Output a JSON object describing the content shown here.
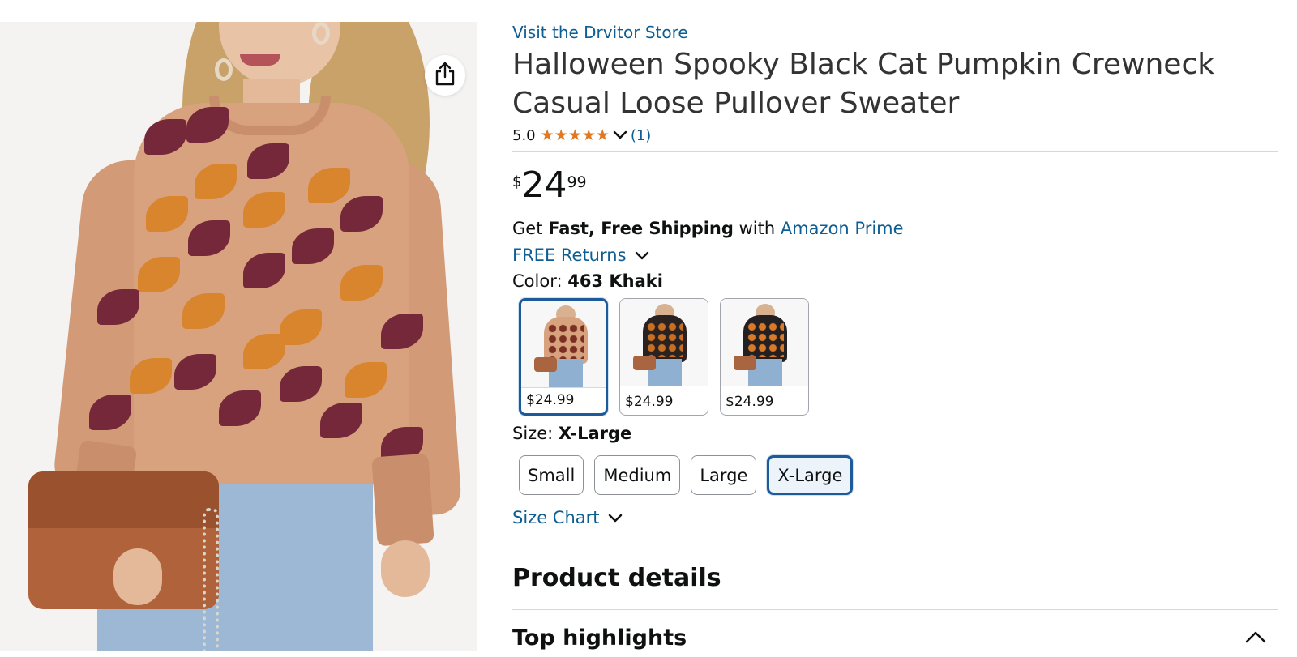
{
  "product": {
    "store_link": "Visit the Drvitor Store",
    "title": "Halloween Spooky Black Cat Pumpkin Crewneck Casual Loose Pullover Sweater",
    "rating": "5.0",
    "rating_count": "(1)",
    "stars": "★★★★★"
  },
  "price": {
    "symbol": "$",
    "whole": "24",
    "fraction": "99"
  },
  "shipping": {
    "prefix": "Get",
    "bold": "Fast, Free Shipping",
    "middle": "with",
    "link": "Amazon Prime"
  },
  "returns": {
    "label": "FREE Returns"
  },
  "color": {
    "label": "Color:",
    "selected": "463 Khaki",
    "options": [
      {
        "price": "$24.99",
        "swatch_color": "#d7a27d",
        "dot_color": "#c96f24"
      },
      {
        "price": "$24.99",
        "swatch_color": "#2a2220",
        "dot_color": "#c96f24"
      },
      {
        "price": "$24.99",
        "swatch_color": "#242021",
        "dot_color": "#d97a2a"
      }
    ]
  },
  "size": {
    "label": "Size:",
    "selected": "X-Large",
    "options": [
      "Small",
      "Medium",
      "Large",
      "X-Large"
    ]
  },
  "size_chart": {
    "label": "Size Chart"
  },
  "sections": {
    "product_details": "Product details",
    "top_highlights": "Top highlights"
  },
  "colors": {
    "link": "#0f5e93",
    "star": "#e07a22",
    "selected_border": "#1c5a9a"
  },
  "icons": {
    "share": "share-icon",
    "chevron_down": "chevron-down-icon",
    "chevron_up": "chevron-up-icon"
  }
}
